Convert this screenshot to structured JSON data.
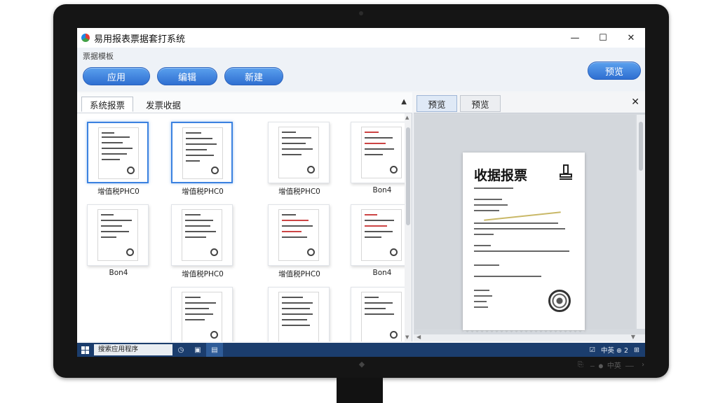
{
  "window": {
    "title": "易用报表票据套打系统",
    "subtitle": "票据模板",
    "controls": {
      "minimize": "—",
      "maximize": "☐",
      "close": "✕"
    }
  },
  "toolbar": {
    "buttons": [
      {
        "label": "应用"
      },
      {
        "label": "编辑"
      },
      {
        "label": "新建"
      }
    ],
    "preview_button": "预览"
  },
  "left_panel": {
    "tabs": [
      {
        "label": "系统报票",
        "active": true
      },
      {
        "label": "发票收据",
        "active": false
      }
    ],
    "collapse_icon": "chevron-up-icon",
    "thumbnails": [
      {
        "label": "增值税PHC0",
        "selected": true
      },
      {
        "label": "增值税PHC0",
        "selected": true
      },
      {
        "label": "增值税PHC0",
        "selected": false
      },
      {
        "label": "Bon4",
        "selected": false
      },
      {
        "label": "Bon4",
        "selected": false
      },
      {
        "label": "增值税PHC0",
        "selected": false
      },
      {
        "label": "增值税PHC0",
        "selected": false
      },
      {
        "label": "Bon4",
        "selected": false
      },
      {
        "label": "",
        "selected": false
      },
      {
        "label": "",
        "selected": false
      },
      {
        "label": "",
        "selected": false
      }
    ]
  },
  "right_panel": {
    "tabs": [
      {
        "label": "预览",
        "active": true
      },
      {
        "label": "预览",
        "active": false
      }
    ],
    "close": "✕",
    "receipt": {
      "title": "收据报票"
    }
  },
  "taskbar": {
    "search_text": "搜索应用程序",
    "tray_text": "中英 ⊕ 2"
  },
  "bezel": {
    "controls_text": "—  ● 中英 ——"
  }
}
